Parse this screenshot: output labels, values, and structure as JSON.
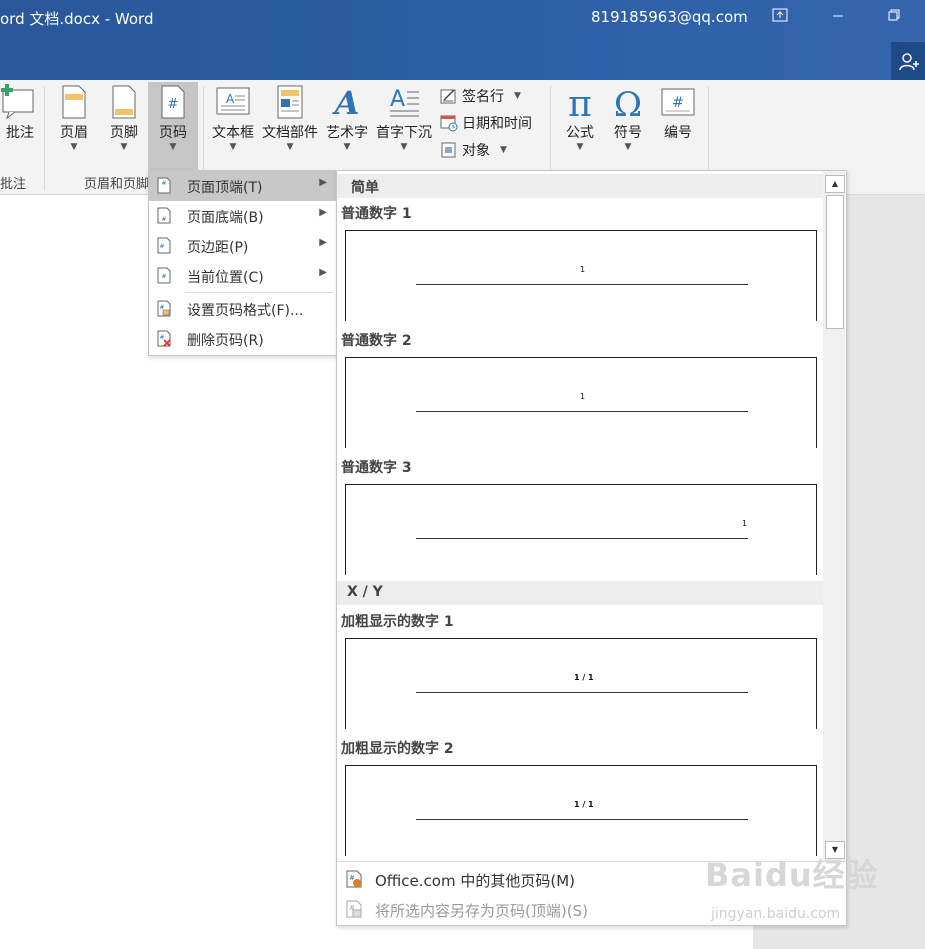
{
  "window": {
    "title": "ord 文档.docx  -  Word",
    "account": "819185963@qq.com"
  },
  "ribbon": {
    "buttons": {
      "comment": "批注",
      "header": "页眉",
      "footer": "页脚",
      "page_number": "页码",
      "textbox": "文本框",
      "quick_parts": "文档部件",
      "wordart": "艺术字",
      "drop_cap": "首字下沉",
      "equation": "公式",
      "symbol": "符号",
      "number": "编号"
    },
    "small": {
      "signature": "签名行",
      "datetime": "日期和时间",
      "object": "对象"
    },
    "groups": {
      "comments": "批注",
      "header_footer": "页眉和页脚"
    }
  },
  "page_number_menu": {
    "items": [
      {
        "label": "页面顶端(T)",
        "active": true,
        "submenu": true
      },
      {
        "label": "页面底端(B)",
        "submenu": true
      },
      {
        "label": "页边距(P)",
        "submenu": true
      },
      {
        "label": "当前位置(C)",
        "submenu": true
      },
      {
        "label": "设置页码格式(F)..."
      },
      {
        "label": "删除页码(R)"
      }
    ]
  },
  "gallery": {
    "categories": [
      {
        "label": "简单"
      },
      {
        "label": "X / Y"
      }
    ],
    "items": [
      {
        "title": "普通数字 1",
        "sample": "1",
        "align": "center"
      },
      {
        "title": "普通数字 2",
        "sample": "1",
        "align": "center"
      },
      {
        "title": "普通数字 3",
        "sample": "1",
        "align": "right"
      },
      {
        "title": "加粗显示的数字 1",
        "sample": "1 / 1",
        "align": "center"
      },
      {
        "title": "加粗显示的数字 2",
        "sample": "1 / 1",
        "align": "center"
      }
    ],
    "footer": {
      "more": "Office.com 中的其他页码(M)",
      "save": "将所选内容另存为页码(顶端)(S)"
    }
  },
  "watermark": {
    "logo": "Baidu经验",
    "url": "jingyan.baidu.com"
  },
  "colors": {
    "title_bar": "#2b579a",
    "ribbon_bg": "#f3f3f3",
    "active_item": "#c8c8c8",
    "accent_blue": "#2e75b6"
  }
}
